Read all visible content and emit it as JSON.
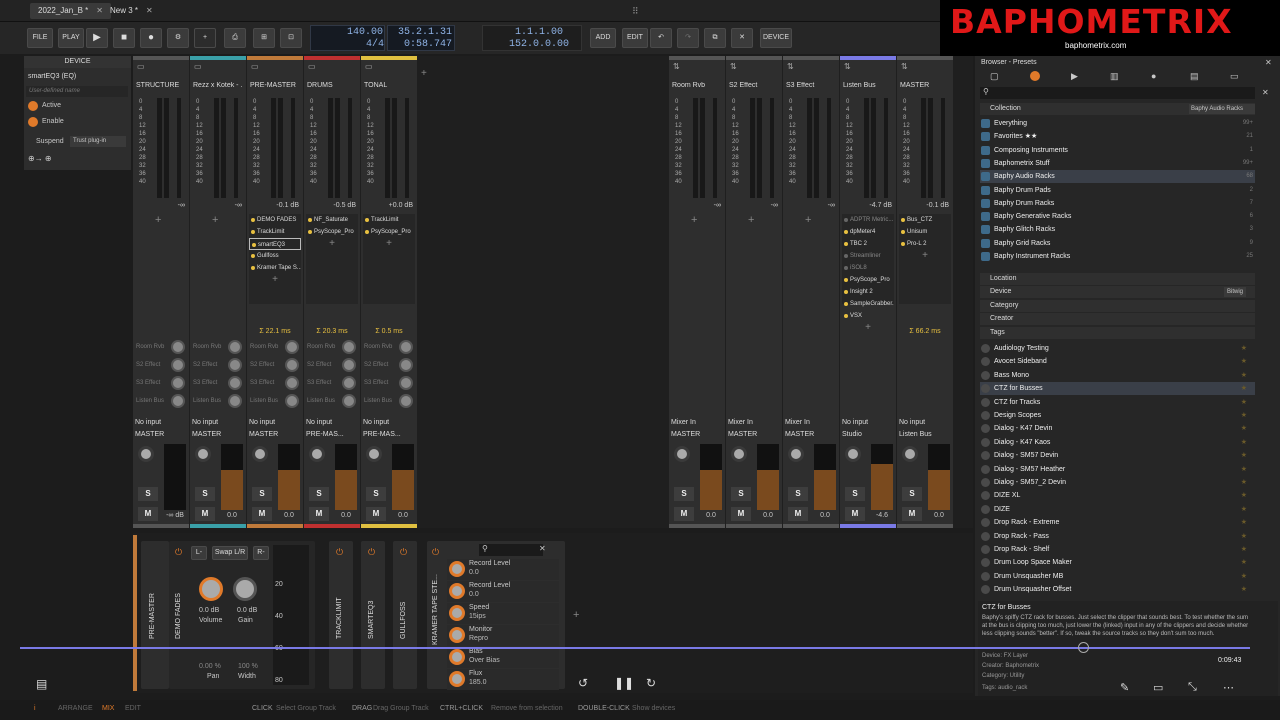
{
  "tabs": [
    {
      "label": "2022_Jan_B *"
    },
    {
      "label": "New 3 *"
    }
  ],
  "toolbar": {
    "file": "FILE",
    "play": "PLAY",
    "tempo": "140.00",
    "sig": "4/4",
    "pos": "35.2.1.31",
    "time": "0:58.747",
    "loop_start": "1.1.1.00",
    "loop_end": "152.0.0.00",
    "add": "ADD",
    "edit": "EDIT",
    "device": "DEVICE"
  },
  "logo": {
    "title": "BAPHOMETRIX",
    "site": "baphometrix.com"
  },
  "device_panel": {
    "title": "DEVICE",
    "name": "smartEQ3 (EQ)",
    "placeholder": "User-defined name",
    "active": "Active",
    "enable": "Enable",
    "suspend": "Suspend",
    "trust": "Trust plug-in"
  },
  "strips": [
    {
      "name": "STRUCTURE",
      "db": "-∞",
      "in": "No input",
      "out": "MASTER",
      "vol": "-∞ dB",
      "color": "#555",
      "cpu": "",
      "devices": [],
      "level": 0
    },
    {
      "name": "Rezz x Kotek - ...",
      "db": "-∞",
      "in": "No input",
      "out": "MASTER",
      "vol": "0.0",
      "color": "#3aa0a8",
      "cpu": "",
      "devices": [],
      "level": 0.6
    },
    {
      "name": "PRE-MASTER",
      "db": "-0.1 dB",
      "in": "No input",
      "out": "MASTER",
      "vol": "0.0",
      "color": "#c07a3a",
      "cpu": "Σ 22.1 ms",
      "devices": [
        "DEMO FADES",
        "TrackLimit",
        "smartEQ3",
        "Gullfoss",
        "Kramer Tape S..."
      ],
      "level": 0.6
    },
    {
      "name": "DRUMS",
      "db": "-0.5 dB",
      "in": "No input",
      "out": "PRE-MAS...",
      "vol": "0.0",
      "color": "#c03030",
      "cpu": "Σ 20.3 ms",
      "devices": [
        "NF_Saturate",
        "PsyScope_Pro"
      ],
      "level": 0.6
    },
    {
      "name": "TONAL",
      "db": "+0.0 dB",
      "in": "No input",
      "out": "PRE-MAS...",
      "vol": "0.0",
      "color": "#e0c040",
      "cpu": "Σ 0.5 ms",
      "devices": [
        "TrackLimit",
        "PsyScope_Pro"
      ],
      "level": 0.6
    }
  ],
  "fx_strips": [
    {
      "name": "Room Rvb",
      "db": "-∞",
      "in": "Mixer In",
      "out": "MASTER",
      "vol": "0.0",
      "color": "#555",
      "level": 0.6
    },
    {
      "name": "S2 Effect",
      "db": "-∞",
      "in": "Mixer In",
      "out": "MASTER",
      "vol": "0.0",
      "color": "#555",
      "level": 0.6
    },
    {
      "name": "S3 Effect",
      "db": "-∞",
      "in": "Mixer In",
      "out": "MASTER",
      "vol": "0.0",
      "color": "#555",
      "level": 0.6
    },
    {
      "name": "Listen Bus",
      "db": "-4.7 dB",
      "in": "No input",
      "out": "Studio",
      "vol": "-4.6",
      "color": "#7a7ae6",
      "level": 0.7,
      "devices": [
        "ADPTR Metric...",
        "dpMeter4",
        "TBC 2",
        "Streamliner",
        "iSOL8",
        "PsyScope_Pro",
        "Insight 2",
        "SampleGrabber...",
        "VSX"
      ]
    },
    {
      "name": "MASTER",
      "db": "-0.1 dB",
      "in": "No input",
      "out": "Listen Bus",
      "vol": "0.0",
      "color": "#555",
      "level": 0.6,
      "cpu": "Σ 66.2 ms",
      "devices": [
        "Bus_CTZ",
        "Unisum",
        "Pro-L 2"
      ]
    }
  ],
  "sends": [
    "Room Rvb",
    "S2 Effect",
    "S3 Effect",
    "Listen Bus"
  ],
  "scale": [
    "0",
    "4",
    "8",
    "12",
    "16",
    "20",
    "24",
    "28",
    "32",
    "36",
    "40"
  ],
  "browser": {
    "title": "Browser - Presets",
    "collection": "Collection",
    "filter_tag": "Baphy Audio Racks",
    "device_tag": "Bitwig",
    "collection_items": [
      {
        "label": "Everything",
        "count": "99+"
      },
      {
        "label": "Favorites ★★",
        "count": "21"
      },
      {
        "label": "Composing Instruments",
        "count": "1"
      },
      {
        "label": "Baphometrix Stuff",
        "count": "99+"
      },
      {
        "label": "Baphy Audio Racks",
        "count": "68"
      },
      {
        "label": "Baphy Drum Pads",
        "count": "2"
      },
      {
        "label": "Baphy Drum Racks",
        "count": "7"
      },
      {
        "label": "Baphy Generative Racks",
        "count": "6"
      },
      {
        "label": "Baphy Glitch Racks",
        "count": "3"
      },
      {
        "label": "Baphy Grid Racks",
        "count": "9"
      },
      {
        "label": "Baphy Instrument Racks",
        "count": "25"
      }
    ],
    "sections": [
      "Location",
      "Device",
      "Category",
      "Creator",
      "Tags"
    ],
    "presets": [
      "Audiology Testing",
      "Avocet Sideband",
      "Bass Mono",
      "CTZ for Busses",
      "CTZ for Tracks",
      "Design Scopes",
      "Dialog - K47 Devin",
      "Dialog - K47 Kaos",
      "Dialog - SM57 Devin",
      "Dialog - SM57 Heather",
      "Dialog - SM57_2 Devin",
      "DIZE XL",
      "DIZE",
      "Drop Rack - Extreme",
      "Drop Rack - Pass",
      "Drop Rack - Shelf",
      "Drum Loop Space Maker",
      "Drum Unsquasher MB",
      "Drum Unsquasher Offset"
    ],
    "info_title": "CTZ for Busses",
    "info_text": "Baphy's spiffy CTZ rack for busses. Just select the clipper that sounds best. To test whether the sum at the bus is clipping too much, just lower the (linked) input in any of the clippers and decide whether less clipping sounds \"better\". If so, tweak the source tracks so they don't sum too much.",
    "meta": [
      "Device: FX Layer",
      "Creator: Baphometrix",
      "Category: Utility",
      "Tags: audio_rack"
    ],
    "time": "0:09:43"
  },
  "chain": {
    "devices": [
      "PRE-MASTER",
      "DEMO FADES",
      "TRACKLIMIT",
      "SMARTEQ3",
      "GULLFOSS",
      "KRAMER TAPE STE..."
    ],
    "swap": "Swap L/R",
    "l": "L-",
    "r": "R-",
    "volume": "Volume",
    "gain": "Gain",
    "vol_val": "0.0 dB",
    "gain_val": "0.0 dB",
    "pan": "Pan",
    "width": "Width",
    "pan_val": "0.00 %",
    "width_val": "100 %",
    "scale": [
      "20",
      "40",
      "60",
      "80"
    ],
    "params": [
      {
        "label": "Record Level",
        "val": "0.0"
      },
      {
        "label": "Record Level",
        "val": "0.0"
      },
      {
        "label": "Speed",
        "val": "15ips"
      },
      {
        "label": "Monitor",
        "val": "Repro"
      },
      {
        "label": "Bias",
        "val": "Over Bias"
      },
      {
        "label": "Flux",
        "val": "185.0"
      }
    ]
  },
  "status": {
    "arrange": "ARRANGE",
    "mix": "MIX",
    "edit": "EDIT",
    "click": "CLICK",
    "click_h": "Select Group Track",
    "drag": "DRAG",
    "drag_h": "Drag Group Track",
    "cc": "CTRL+CLICK",
    "cc_h": "Remove from selection",
    "dc": "DOUBLE-CLICK",
    "dc_h": "Show devices"
  }
}
